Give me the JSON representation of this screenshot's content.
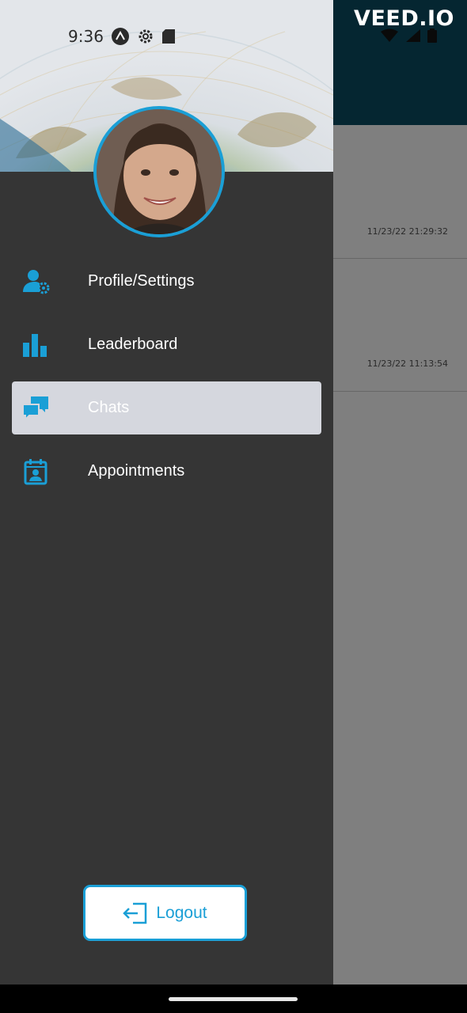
{
  "status_bar": {
    "time": "9:36",
    "left_icons": [
      "app-a-icon",
      "gear-icon",
      "sd-card-icon"
    ],
    "right_icons": [
      "wifi-icon",
      "signal-icon",
      "battery-icon"
    ]
  },
  "watermark": "VEED.IO",
  "background_list": {
    "items": [
      {
        "timestamp": "11/23/22 21:29:32"
      },
      {
        "timestamp": "11/23/22 11:13:54"
      }
    ]
  },
  "drawer": {
    "menu": [
      {
        "label": "Profile/Settings",
        "icon": "user-settings-icon",
        "active": false
      },
      {
        "label": "Leaderboard",
        "icon": "bar-chart-icon",
        "active": false
      },
      {
        "label": "Chats",
        "icon": "chat-bubbles-icon",
        "active": true
      },
      {
        "label": "Appointments",
        "icon": "calendar-contact-icon",
        "active": false
      }
    ],
    "logout_label": "Logout"
  },
  "colors": {
    "accent": "#1a9fd6",
    "drawer_bg": "#353535",
    "header_bg": "#0b4c63",
    "active_item_bg": "#d5d7de"
  }
}
